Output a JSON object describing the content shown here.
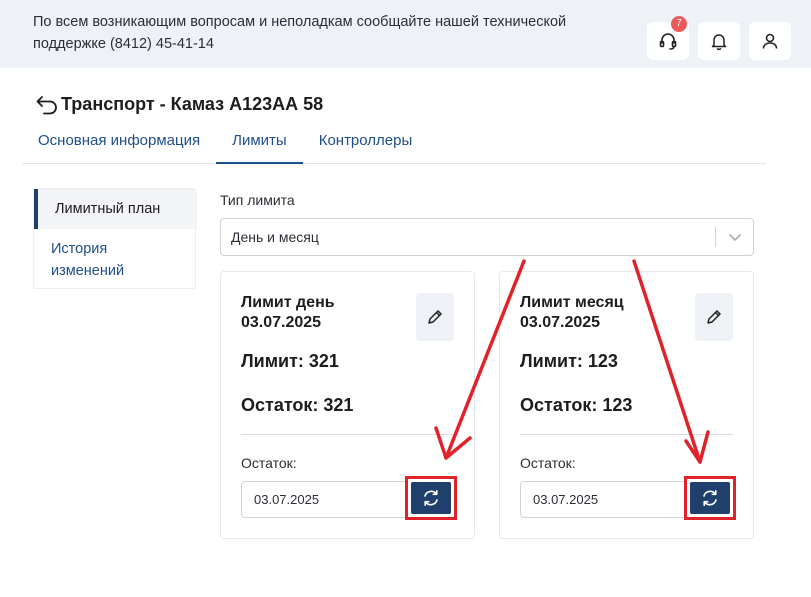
{
  "header": {
    "notice": "По всем возникающим вопросам и неполадкам сообщайте нашей технической поддержке (8412) 45-41-14",
    "support_badge": "7",
    "icons": [
      "headset-icon",
      "bell-icon",
      "user-icon"
    ]
  },
  "page": {
    "title": "Транспорт - Камаз А123АА 58"
  },
  "tabs": [
    {
      "label": "Основная информация",
      "active": false
    },
    {
      "label": "Лимиты",
      "active": true
    },
    {
      "label": "Контроллеры",
      "active": false
    }
  ],
  "side_menu": {
    "items": [
      {
        "label": "Лимитный план",
        "active": true
      },
      {
        "label": "История изменений",
        "active": false
      }
    ]
  },
  "limit_type": {
    "label": "Тип лимита",
    "value": "День и месяц"
  },
  "cards": [
    {
      "title": "Лимит день 03.07.2025",
      "limit": "Лимит: 321",
      "rest": "Остаток: 321",
      "rest_label": "Остаток:",
      "date": "03.07.2025"
    },
    {
      "title": "Лимит месяц 03.07.2025",
      "limit": "Лимит: 123",
      "rest": "Остаток: 123",
      "rest_label": "Остаток:",
      "date": "03.07.2025"
    }
  ],
  "colors": {
    "topbar": "#eef1f6",
    "accent": "#1f3f6c",
    "link": "#1f4f8a",
    "annotation": "#e0232a",
    "badge": "#ee5a5a"
  }
}
